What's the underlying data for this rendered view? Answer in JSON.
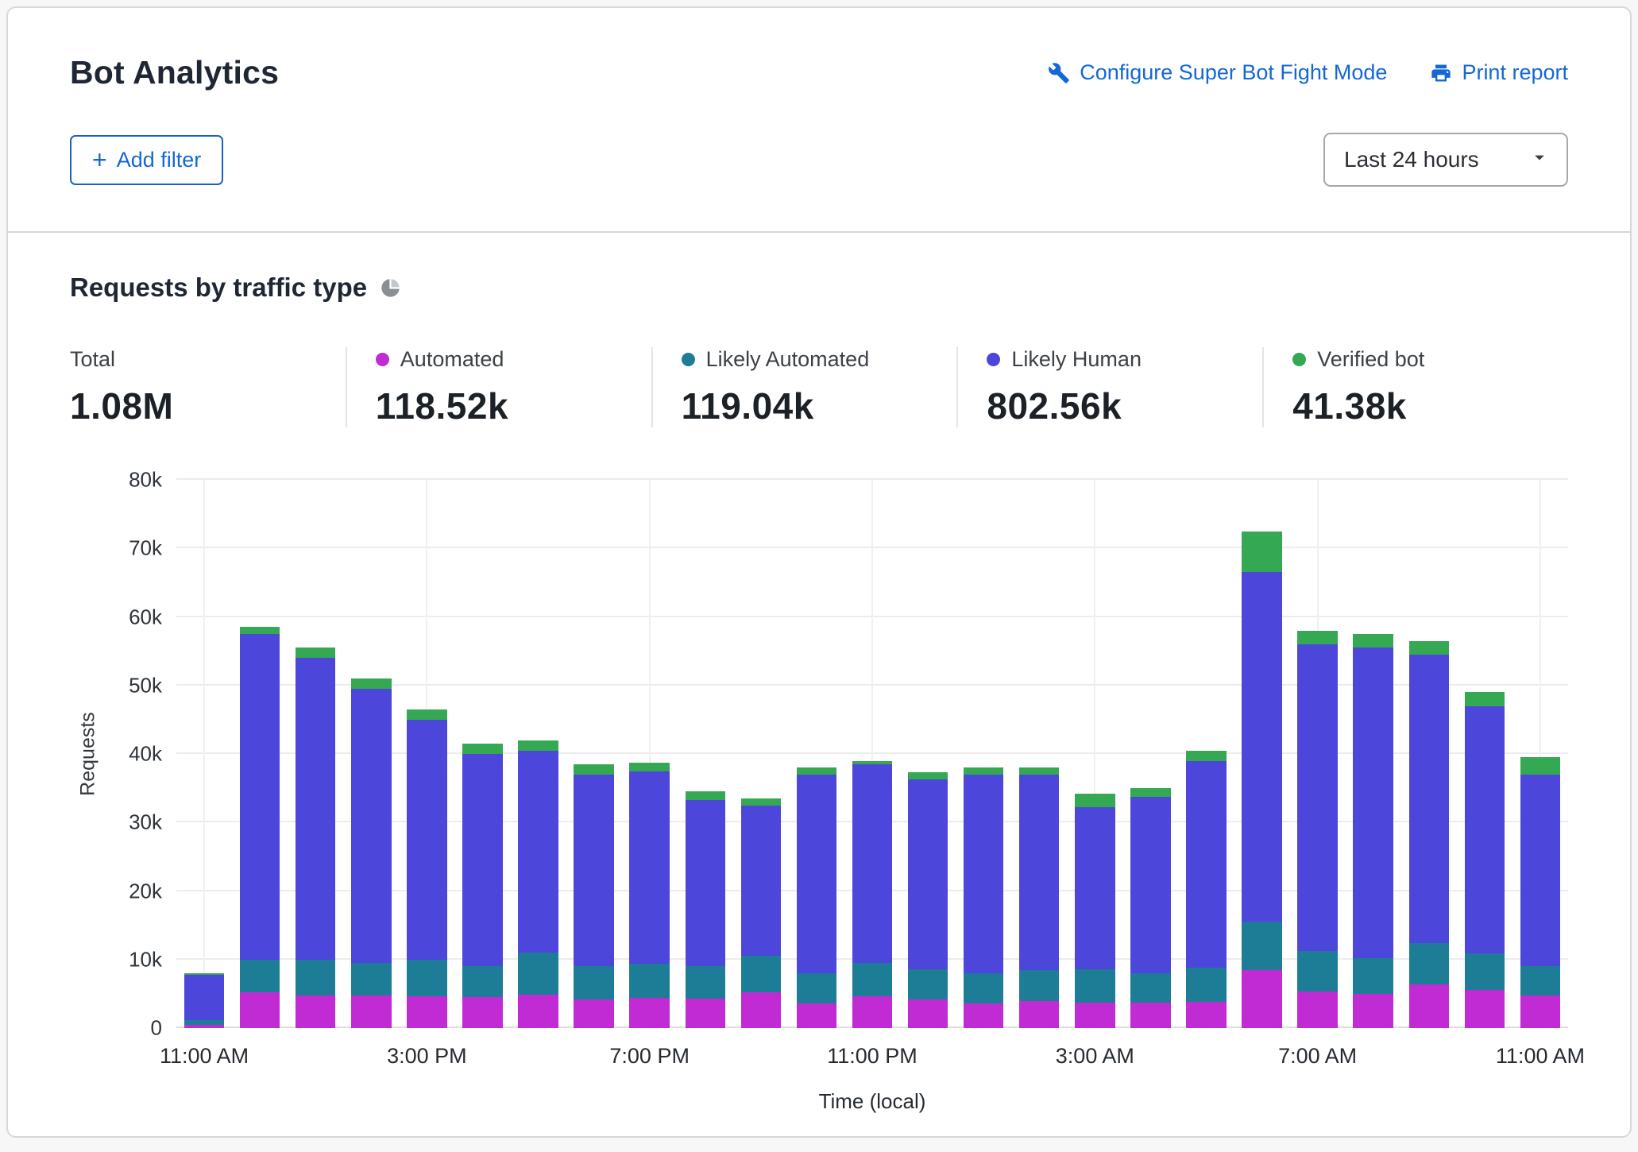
{
  "header": {
    "title": "Bot Analytics",
    "configure_label": "Configure Super Bot Fight Mode",
    "print_label": "Print report",
    "plus": "+",
    "add_filter_label": "Add filter",
    "time_range_value": "Last 24 hours"
  },
  "section": {
    "title": "Requests by traffic type"
  },
  "stats": [
    {
      "id": "total",
      "label": "Total",
      "value": "1.08M",
      "color": ""
    },
    {
      "id": "automated",
      "label": "Automated",
      "value": "118.52k",
      "color": "#c02bd4"
    },
    {
      "id": "likely-automated",
      "label": "Likely Automated",
      "value": "119.04k",
      "color": "#1d7d96"
    },
    {
      "id": "likely-human",
      "label": "Likely Human",
      "value": "802.56k",
      "color": "#4c46db"
    },
    {
      "id": "verified-bot",
      "label": "Verified bot",
      "value": "41.38k",
      "color": "#35a854"
    }
  ],
  "chart_data": {
    "type": "bar",
    "stacked": true,
    "title": "Requests by traffic type",
    "xlabel": "Time (local)",
    "ylabel": "Requests",
    "ylim": [
      0,
      80000
    ],
    "grid": true,
    "legend_position": "top",
    "ytick_labels": [
      "0",
      "10k",
      "20k",
      "30k",
      "40k",
      "50k",
      "60k",
      "70k",
      "80k"
    ],
    "bar_count": 25,
    "xticks": [
      {
        "index": 0,
        "label": "11:00 AM"
      },
      {
        "index": 4,
        "label": "3:00 PM"
      },
      {
        "index": 8,
        "label": "7:00 PM"
      },
      {
        "index": 12,
        "label": "11:00 PM"
      },
      {
        "index": 16,
        "label": "3:00 AM"
      },
      {
        "index": 20,
        "label": "7:00 AM"
      },
      {
        "index": 24,
        "label": "11:00 AM"
      }
    ],
    "series": [
      {
        "name": "Automated",
        "color": "#c02bd4",
        "values": [
          500,
          5200,
          4700,
          4700,
          4600,
          4500,
          4900,
          4200,
          4400,
          4300,
          5200,
          3600,
          4600,
          4200,
          3600,
          3900,
          3700,
          3700,
          3800,
          8500,
          5300,
          5000,
          6400,
          5600,
          4700
        ]
      },
      {
        "name": "Likely Automated",
        "color": "#1d7d96",
        "values": [
          700,
          4800,
          5300,
          4800,
          5400,
          4500,
          6100,
          4800,
          5000,
          4700,
          5300,
          4400,
          4900,
          4400,
          4400,
          4600,
          4900,
          4300,
          5000,
          7000,
          6000,
          5200,
          6000,
          5300,
          4300
        ]
      },
      {
        "name": "Likely Human",
        "color": "#4c46db",
        "values": [
          6600,
          47500,
          44000,
          40000,
          35000,
          31000,
          29500,
          28000,
          28000,
          24300,
          22000,
          29000,
          29000,
          27700,
          29000,
          28500,
          23600,
          25700,
          30200,
          51000,
          44700,
          45300,
          42100,
          36100,
          28000
        ]
      },
      {
        "name": "Verified bot",
        "color": "#35a854",
        "values": [
          200,
          1000,
          1500,
          1500,
          1500,
          1500,
          1500,
          1500,
          1300,
          1200,
          1000,
          1000,
          500,
          1000,
          1000,
          1000,
          2000,
          1300,
          1500,
          6000,
          2000,
          2000,
          2000,
          2000,
          2500
        ]
      }
    ]
  }
}
